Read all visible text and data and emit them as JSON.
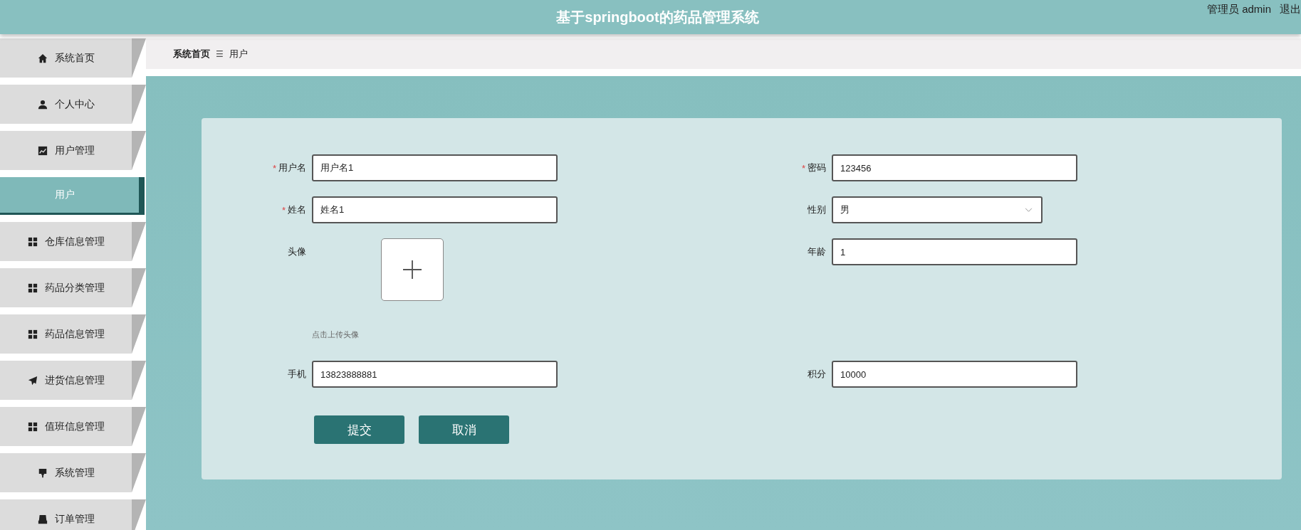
{
  "header": {
    "title": "基于springboot的药品管理系统",
    "user": "管理员 admin",
    "logout": "退出"
  },
  "sidebar": {
    "items": [
      {
        "label": "系统首页",
        "selected": false
      },
      {
        "label": "个人中心",
        "selected": false
      },
      {
        "label": "用户管理",
        "selected": false,
        "children": [
          {
            "label": "用户",
            "selected": true
          }
        ]
      },
      {
        "label": "仓库信息管理",
        "selected": false
      },
      {
        "label": "药品分类管理",
        "selected": false
      },
      {
        "label": "药品信息管理",
        "selected": false
      },
      {
        "label": "进货信息管理",
        "selected": false
      },
      {
        "label": "值班信息管理",
        "selected": false
      },
      {
        "label": "系统管理",
        "selected": false
      },
      {
        "label": "订单管理",
        "selected": false
      }
    ]
  },
  "breadcrumb": {
    "items": [
      "系统首页",
      "用户"
    ],
    "separator": "☰"
  },
  "form": {
    "required_mark": "*",
    "fields": [
      {
        "label": "用户名",
        "required": true,
        "kind": "text",
        "value": "用户名1"
      },
      {
        "label": "密码",
        "required": true,
        "kind": "text",
        "value": "123456"
      },
      {
        "label": "姓名",
        "required": true,
        "kind": "text",
        "value": "姓名1"
      },
      {
        "label": "性别",
        "required": false,
        "kind": "select",
        "value": "男"
      },
      {
        "label": "头像",
        "required": false,
        "kind": "upload",
        "hint": "点击上传头像"
      },
      {
        "label": "年龄",
        "required": false,
        "kind": "text",
        "value": "1"
      },
      {
        "label": "手机",
        "required": false,
        "kind": "text",
        "value": "13823888881"
      },
      {
        "label": "积分",
        "required": false,
        "kind": "text",
        "value": "10000"
      }
    ],
    "buttons": [
      "提交",
      "取消"
    ]
  }
}
